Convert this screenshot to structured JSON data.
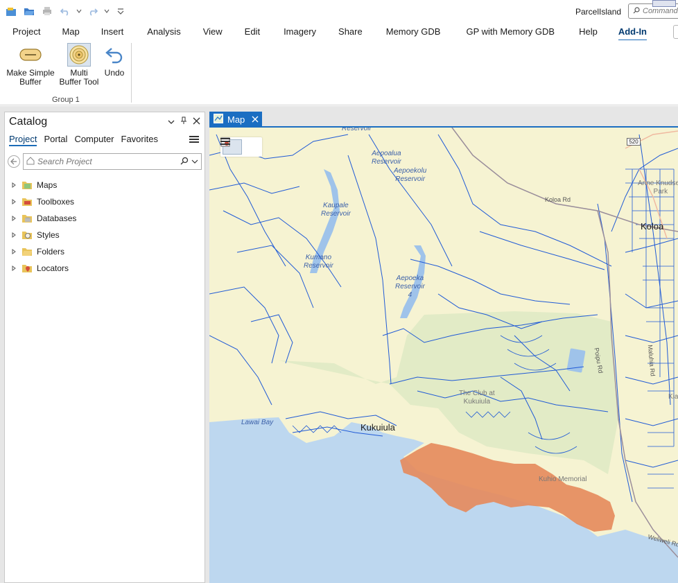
{
  "qat": {
    "icons": [
      "new-project-icon",
      "open-project-icon",
      "print-icon",
      "undo-icon",
      "redo-icon",
      "customize-icon"
    ]
  },
  "title": {
    "project_name": "ParcelIsland"
  },
  "command_search": {
    "placeholder": "Command Search"
  },
  "ribbon": {
    "tabs": [
      "Project",
      "Map",
      "Insert",
      "Analysis",
      "View",
      "Edit",
      "Imagery",
      "Share",
      "Memory GDB",
      "GP with Memory GDB",
      "Help",
      "Add-In"
    ],
    "active_tab": "Add-In",
    "buttons": [
      {
        "label": "Make Simple Buffer",
        "line1": "Make Simple",
        "line2": "Buffer",
        "icon": "simple-buffer-icon"
      },
      {
        "label": "Multi Buffer Tool",
        "line1": "Multi",
        "line2": "Buffer Tool",
        "icon": "multi-buffer-icon"
      },
      {
        "label": "Undo",
        "line1": "Undo",
        "line2": "",
        "icon": "undo-icon"
      }
    ],
    "group_label": "Group 1"
  },
  "catalog": {
    "title": "Catalog",
    "tabs": [
      "Project",
      "Portal",
      "Computer",
      "Favorites"
    ],
    "active_tab": "Project",
    "search_placeholder": "Search Project",
    "items": [
      {
        "label": "Maps",
        "icon": "maps-folder-icon"
      },
      {
        "label": "Toolboxes",
        "icon": "toolboxes-icon"
      },
      {
        "label": "Databases",
        "icon": "databases-icon"
      },
      {
        "label": "Styles",
        "icon": "styles-icon"
      },
      {
        "label": "Folders",
        "icon": "folders-icon"
      },
      {
        "label": "Locators",
        "icon": "locators-icon"
      }
    ]
  },
  "map": {
    "tab_label": "Map",
    "labels": {
      "reservoir_top": "Reservoir",
      "aepoalua": "Aepoalua\nReservoir",
      "aepoekolu": "Aepoekolu\nReservoir",
      "kaupale": "Kaupale\nReservoir",
      "kumano": "Kumano\nReservoir",
      "aepoeka": "Aepoeka\nReservoir\n4",
      "koloa_rd": "Koloa Rd",
      "koloa": "Koloa",
      "anne_knudsen": "Anne Knudsen\nPark",
      "club": "The Club at\nKukuiula",
      "lawai_bay": "Lawai Bay",
      "kukuiula": "Kukuiula",
      "kuhio": "Kuhio Memorial",
      "route_shield": "520",
      "poipu_rd": "Poipu Rd",
      "maluhia": "Maluhia Rd",
      "kiahuna": "Kia",
      "weliweli": "Weliweli Rd"
    },
    "colors": {
      "ocean": "#bdd7ef",
      "land": "#f6f3d2",
      "golf": "#e2ebc6",
      "parcel_line": "#1f5ad6",
      "buffer": "#e58a5b"
    }
  }
}
